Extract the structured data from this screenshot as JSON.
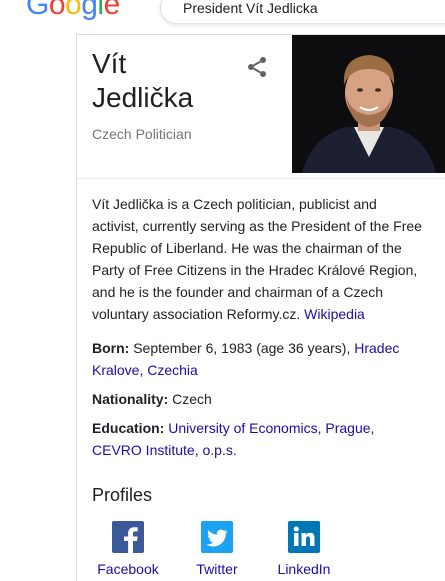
{
  "header": {
    "logo_letters": [
      "G",
      "o",
      "o",
      "g",
      "l",
      "e"
    ],
    "search_query": "President Vít Jedlicka"
  },
  "panel": {
    "title": "Vít Jedlička",
    "subtitle": "Czech Politician",
    "description": "Vít Jedlička is a Czech politician, publicist and activist, currently serving as the President of the Free Republic of Liberland. He was the chairman of the Party of Free Citizens in the Hradec Králové Region, and he is the founder and chairman of a Czech voluntary association Reformy.cz.",
    "description_link": "Wikipedia",
    "facts": {
      "born_label": "Born:",
      "born_text": "September 6, 1983 (age 36 years),",
      "born_link": "Hradec Kralove, Czechia",
      "nationality_label": "Nationality:",
      "nationality_value": "Czech",
      "education_label": "Education:",
      "education_link1": "University of Economics, Prague",
      "education_link2": "CEVRO Institute, o.p.s."
    },
    "profiles_heading": "Profiles",
    "profiles": [
      {
        "label": "Facebook",
        "icon": "facebook-icon",
        "color": "#3b5998"
      },
      {
        "label": "Twitter",
        "icon": "twitter-icon",
        "color": "#1da1f2"
      },
      {
        "label": "LinkedIn",
        "icon": "linkedin-icon",
        "color": "#0077b5"
      }
    ]
  }
}
